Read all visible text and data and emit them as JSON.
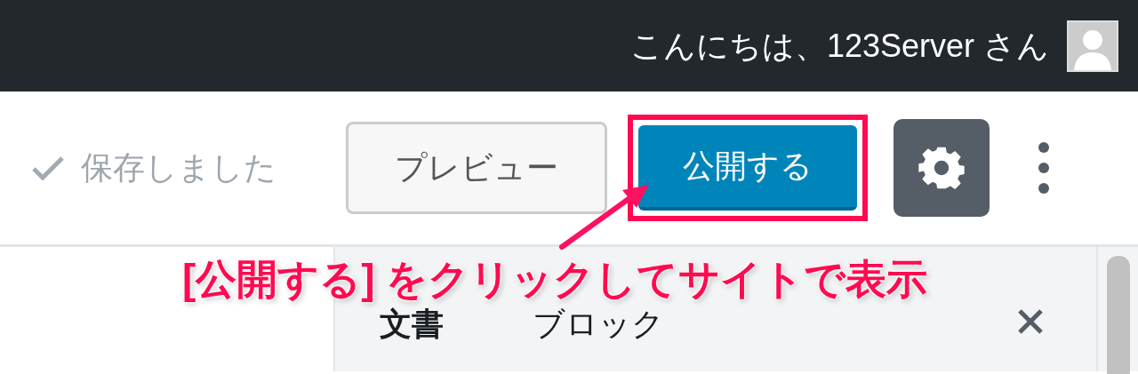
{
  "top_bar": {
    "greeting": "こんにちは、123Server さん"
  },
  "toolbar": {
    "save_status": "保存しました",
    "preview_button": "プレビュー",
    "publish_button": {
      "label": "公開する",
      "highlighted": true
    },
    "settings_button": {
      "selected": true
    }
  },
  "annotation": "[公開する] をクリックしてサイトで表示",
  "sidebar": {
    "tabs": [
      {
        "label": "文書",
        "selected": true
      },
      {
        "label": "ブロック",
        "selected": false
      }
    ]
  }
}
